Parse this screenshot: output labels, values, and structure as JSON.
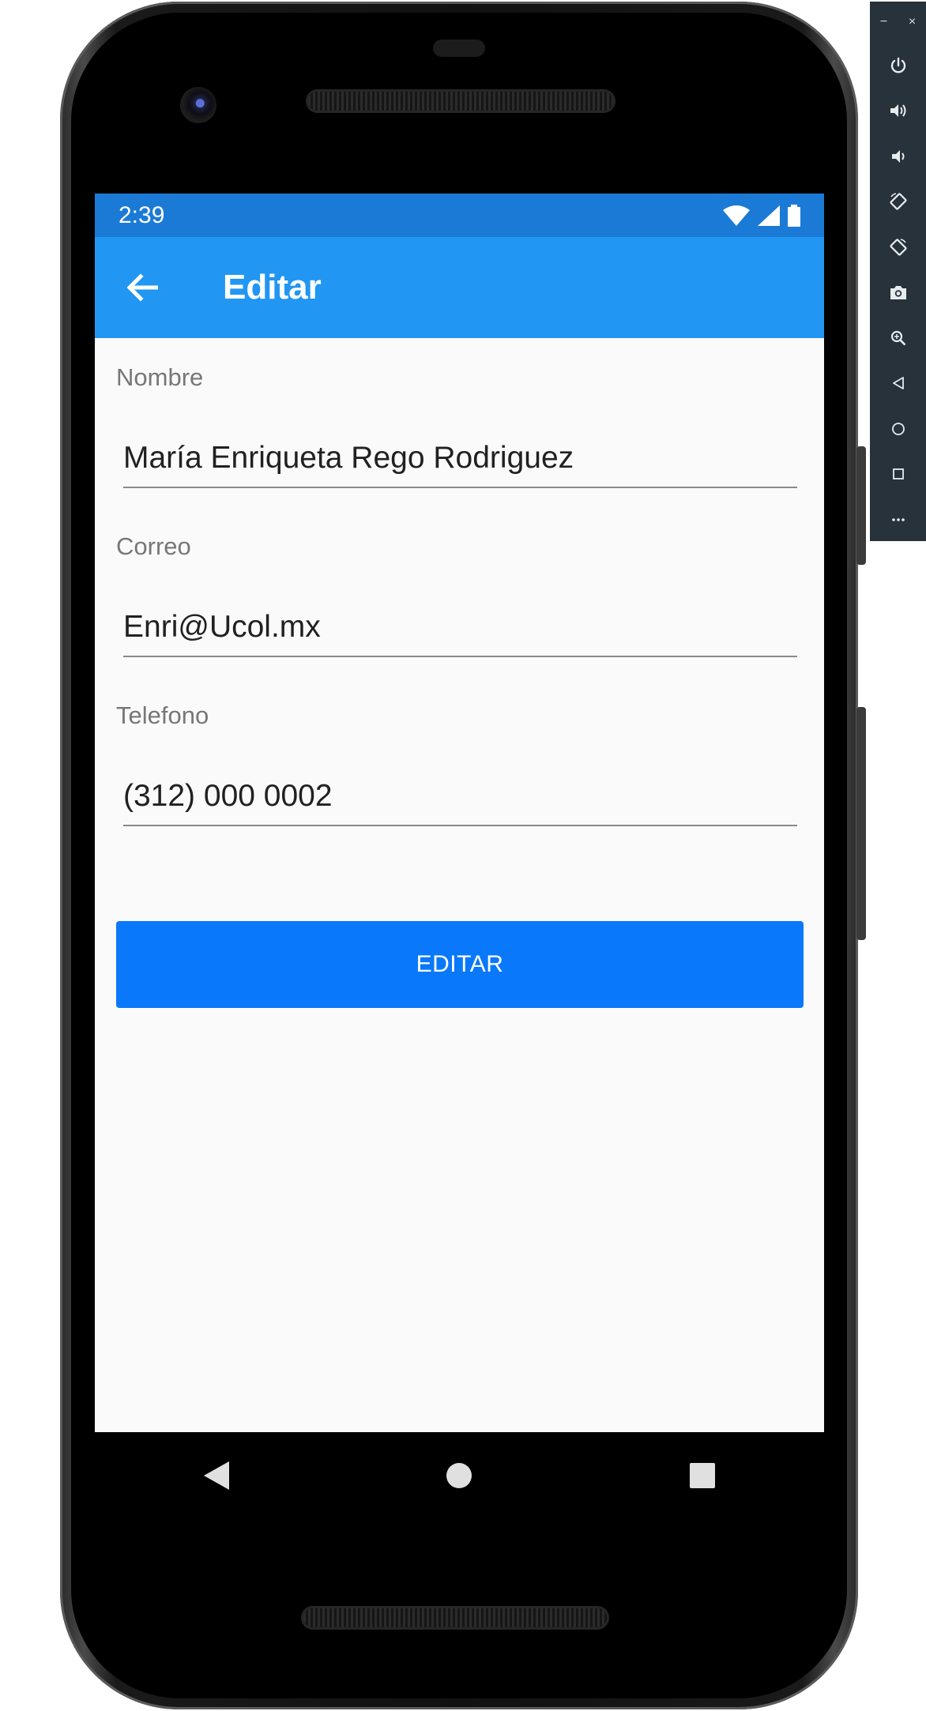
{
  "status_bar": {
    "time": "2:39",
    "icons": [
      "wifi-icon",
      "cell-signal-icon",
      "battery-icon"
    ]
  },
  "app_bar": {
    "back_icon": "arrow-left-icon",
    "title": "Editar",
    "color": "#2196f3",
    "status_color": "#1b7ad6"
  },
  "form": {
    "fields": [
      {
        "label": "Nombre",
        "value": "María Enriqueta Rego Rodriguez"
      },
      {
        "label": "Correo",
        "value": "Enri@Ucol.mx"
      },
      {
        "label": "Telefono",
        "value": "(312) 000 0002"
      }
    ],
    "submit_label": "EDITAR",
    "submit_color": "#0a78fa"
  },
  "nav_bar": {
    "buttons": [
      "back-triangle-icon",
      "home-circle-icon",
      "recents-square-icon"
    ]
  },
  "emulator_toolbar": {
    "window_controls": {
      "minimize": "−",
      "close": "×"
    },
    "items": [
      "power-icon",
      "volume-up-icon",
      "volume-down-icon",
      "rotate-left-icon",
      "rotate-right-icon",
      "camera-icon",
      "zoom-icon",
      "back-icon",
      "home-icon",
      "overview-icon",
      "more-icon"
    ]
  }
}
